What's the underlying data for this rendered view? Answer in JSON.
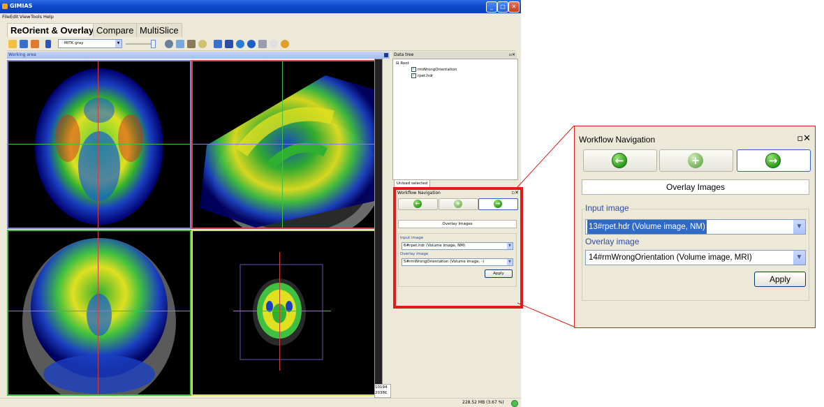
{
  "window": {
    "title": "GIMIAS"
  },
  "menu": [
    "File",
    "Edit",
    "View",
    "Tools",
    "Help"
  ],
  "tabs": [
    "ReOrient & Overlay",
    "Compare",
    "MultiSlice"
  ],
  "toolbar": {
    "colormap_value": "MITK gray"
  },
  "working_area": {
    "title": "Working area",
    "scroll_values": [
      "10194",
      "2038€"
    ]
  },
  "data_tree": {
    "title": "Data tree",
    "root": "Root",
    "items": [
      "rmWrongOrientation",
      "rpet.hdr"
    ],
    "unload_button": "Unload selected"
  },
  "workflow_small": {
    "title": "Workflow Navigation",
    "step_title": "Overlay Images",
    "input_label": "Input image",
    "input_value": "6#rpet.hdr (Volume image, NM)",
    "overlay_label": "Overlay image",
    "overlay_value": "5#rmWrongOrientation (Volume image, -)",
    "apply_label": "Apply"
  },
  "workflow_large": {
    "title": "Workflow Navigation",
    "step_title": "Overlay Images",
    "input_label": "Input image",
    "input_value": "13#rpet.hdr (Volume image, NM)",
    "overlay_label": "Overlay image",
    "overlay_value": "14#rmWrongOrientation (Volume image, MRI)",
    "apply_label": "Apply"
  },
  "status": {
    "memory": "228.52 MB (3.67 %)"
  },
  "colors": {
    "highlight": "#e01b1b",
    "nav_green": "#2c9a18",
    "xp_blue": "#0a46c8"
  }
}
